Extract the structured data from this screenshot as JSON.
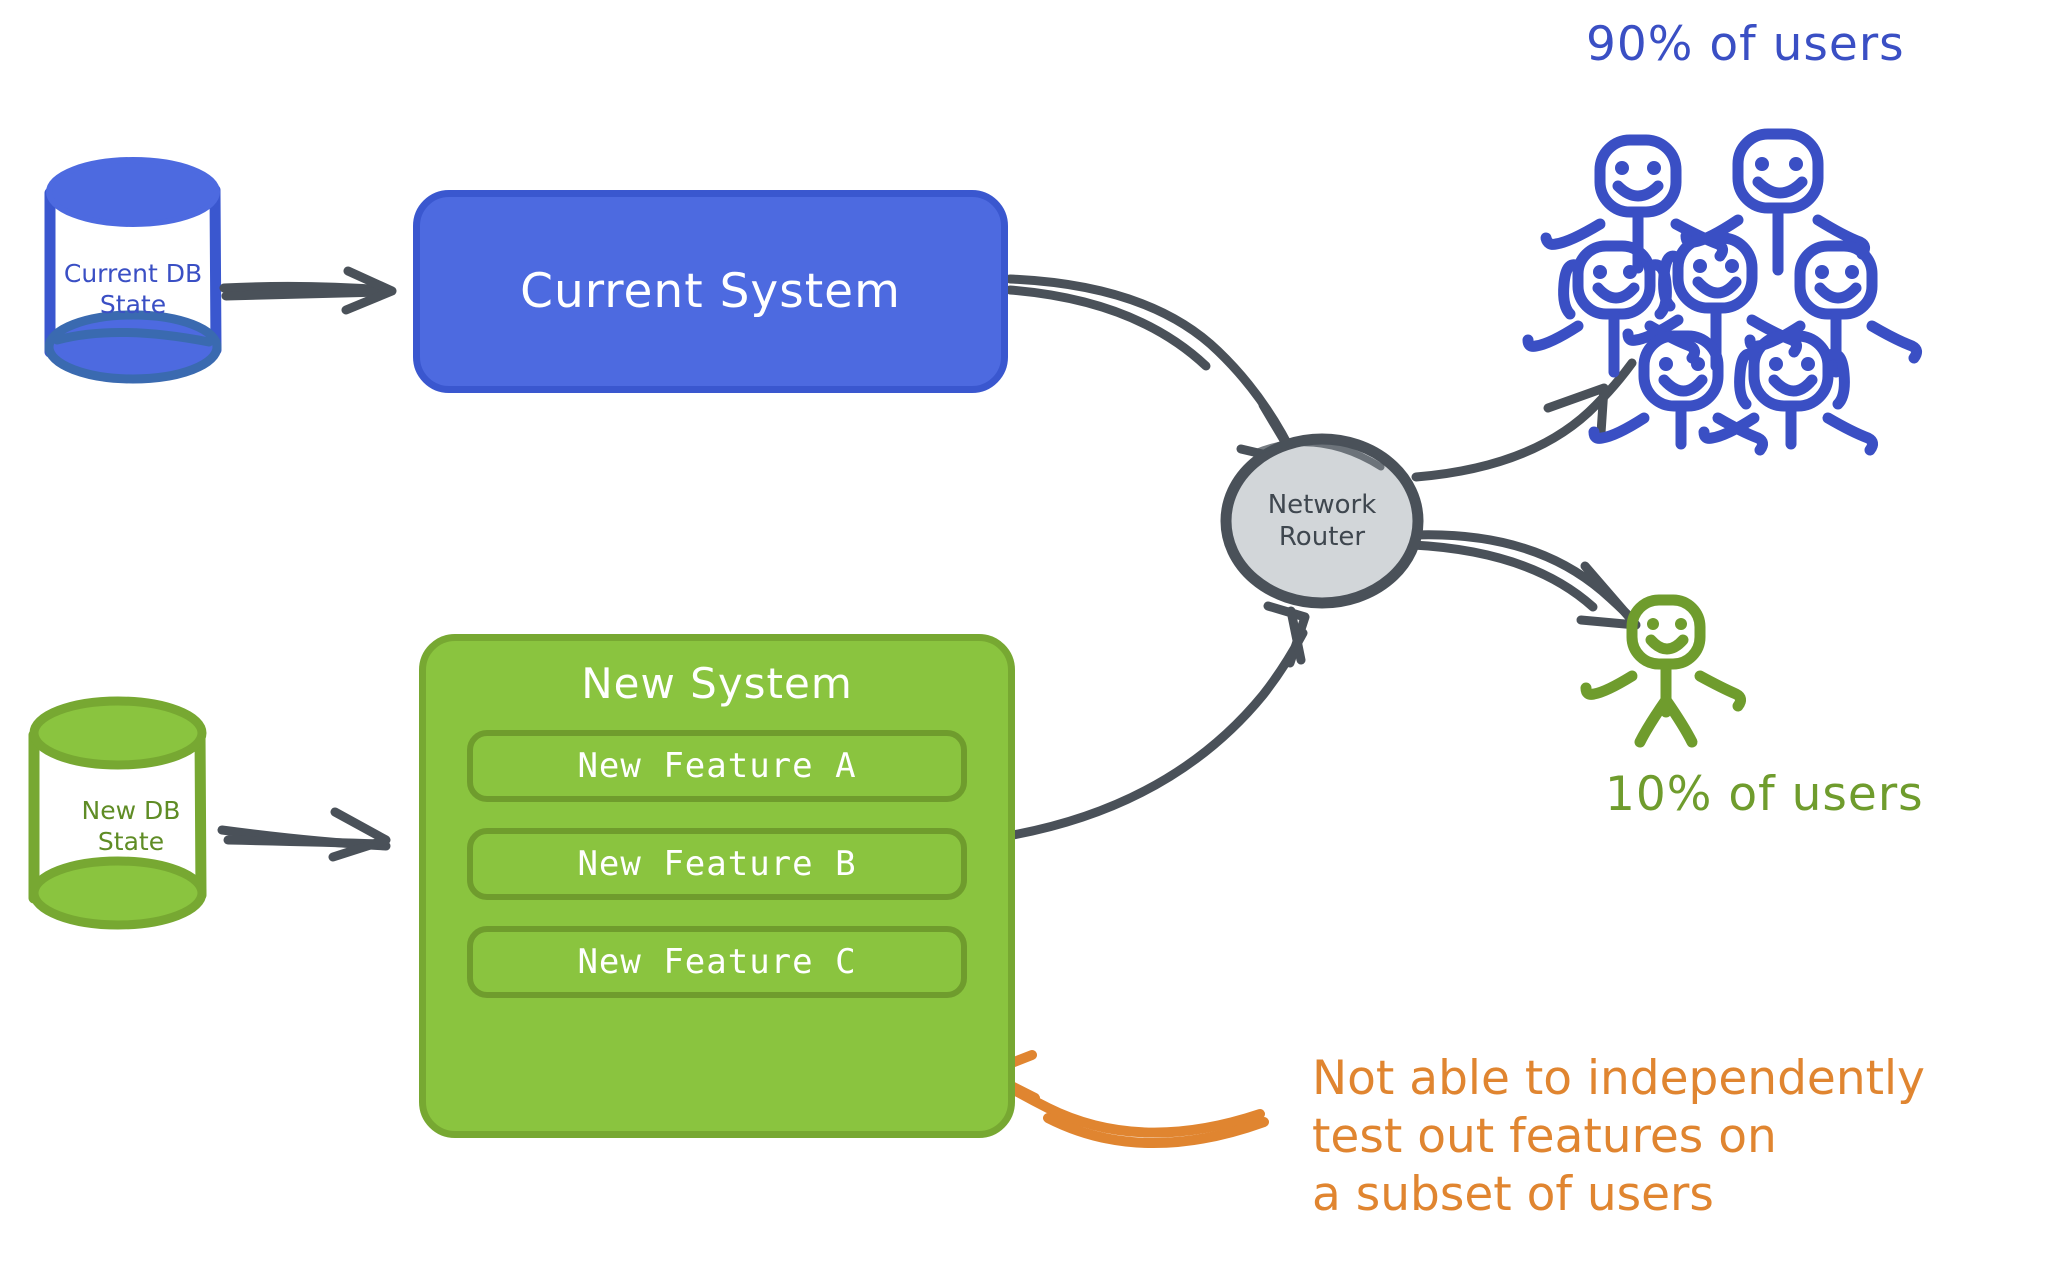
{
  "diagram": {
    "title": "Current System vs New System canary routing diagram",
    "background_color": "#ffffff"
  },
  "colors": {
    "blue_fill": "#4d6ae0",
    "blue_stroke": "#3a57cf",
    "blue_text": "#3a4fc4",
    "green_fill": "#8ac43f",
    "green_stroke": "#77a832",
    "green_inner_stroke": "#6f9c2d",
    "green_text": "#6f9c2d",
    "gray_stroke": "#4a5159",
    "gray_fill": "#d2d6d9",
    "orange": "#e08530",
    "white": "#ffffff"
  },
  "databases": [
    {
      "id": "current-db",
      "label": "Current DB\nState",
      "color": "#3a4fc4",
      "fill": "#4d6ae0"
    },
    {
      "id": "new-db",
      "label": "New DB\nState",
      "color": "#6f9c2d",
      "fill": "#8ac43f"
    }
  ],
  "current_system": {
    "label": "Current System"
  },
  "new_system": {
    "label": "New System",
    "features": [
      {
        "label": "New Feature A"
      },
      {
        "label": "New Feature B"
      },
      {
        "label": "New Feature C"
      }
    ]
  },
  "router": {
    "line1": "Network",
    "line2": "Router"
  },
  "user_groups": [
    {
      "id": "majority-users",
      "label": "90% of users",
      "color": "#3a4fc4",
      "figure_count": 7
    },
    {
      "id": "canary-users",
      "label": "10% of users",
      "color": "#6f9c2d",
      "figure_count": 1
    }
  ],
  "annotation": {
    "text": "Not able to independently\ntest out features on\na subset of users",
    "color": "#e08530"
  }
}
